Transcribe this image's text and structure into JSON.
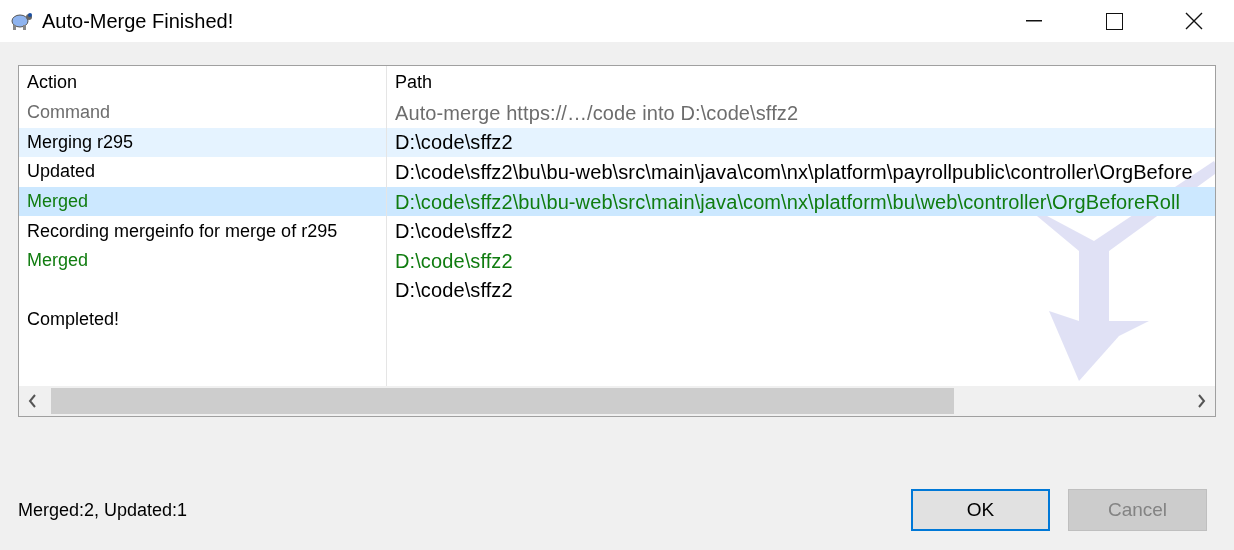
{
  "window": {
    "title": "Auto-Merge Finished!"
  },
  "table": {
    "columns": [
      "Action",
      "Path"
    ],
    "rows": [
      {
        "kind": "command",
        "action": "Command",
        "path": "Auto-merge https://…/code into D:\\code\\sffz2",
        "selected": false,
        "hovered": false
      },
      {
        "kind": "normal",
        "action": "Merging r295",
        "path": "D:\\code\\sffz2",
        "selected": false,
        "hovered": true
      },
      {
        "kind": "normal",
        "action": "Updated",
        "path": "D:\\code\\sffz2\\bu\\bu-web\\src\\main\\java\\com\\nx\\platform\\payrollpublic\\controller\\OrgBefore",
        "selected": false,
        "hovered": false
      },
      {
        "kind": "merged",
        "action": "Merged",
        "path": "D:\\code\\sffz2\\bu\\bu-web\\src\\main\\java\\com\\nx\\platform\\bu\\web\\controller\\OrgBeforeRoll",
        "selected": true,
        "hovered": false
      },
      {
        "kind": "normal",
        "action": "Recording mergeinfo for merge of r295",
        "path": "D:\\code\\sffz2",
        "selected": false,
        "hovered": false
      },
      {
        "kind": "merged",
        "action": "Merged",
        "path": "D:\\code\\sffz2",
        "selected": false,
        "hovered": false
      },
      {
        "kind": "normal",
        "path": "D:\\code\\sffz2",
        "selected": false,
        "hovered": false
      },
      {
        "kind": "normal",
        "action": "Completed!",
        "selected": false,
        "hovered": false
      }
    ]
  },
  "summary": "Merged:2, Updated:1",
  "buttons": [
    {
      "label": "OK",
      "default": true,
      "disabled": false
    },
    {
      "label": "Cancel",
      "default": false,
      "disabled": true
    }
  ]
}
